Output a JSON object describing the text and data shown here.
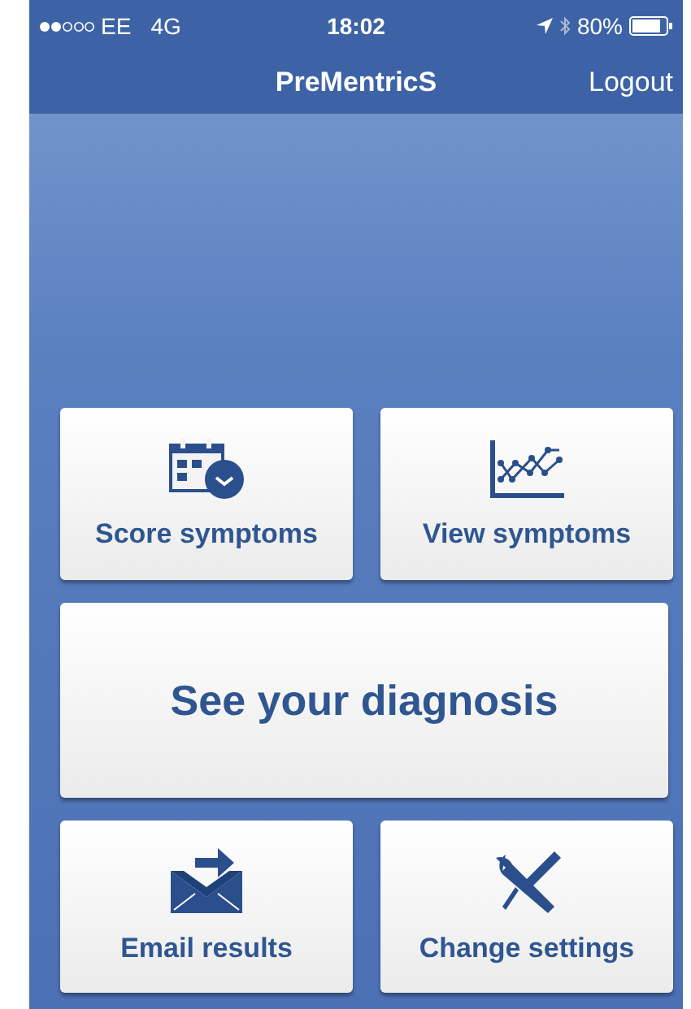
{
  "status_bar": {
    "carrier": "EE",
    "network": "4G",
    "time": "18:02",
    "battery": "80%"
  },
  "nav_bar": {
    "title": "PreMentricS",
    "action": "Logout"
  },
  "rows": [
    {
      "tiles": [
        {
          "label": "Score symptoms",
          "kind": "icon"
        },
        {
          "label": "View symptoms",
          "kind": "icon"
        }
      ]
    },
    {
      "tiles": [
        {
          "label": "See your diagnosis",
          "kind": "wide"
        }
      ]
    },
    {
      "tiles": [
        {
          "label": "Email results",
          "kind": "icon"
        },
        {
          "label": "Change settings",
          "kind": "icon"
        }
      ]
    }
  ]
}
